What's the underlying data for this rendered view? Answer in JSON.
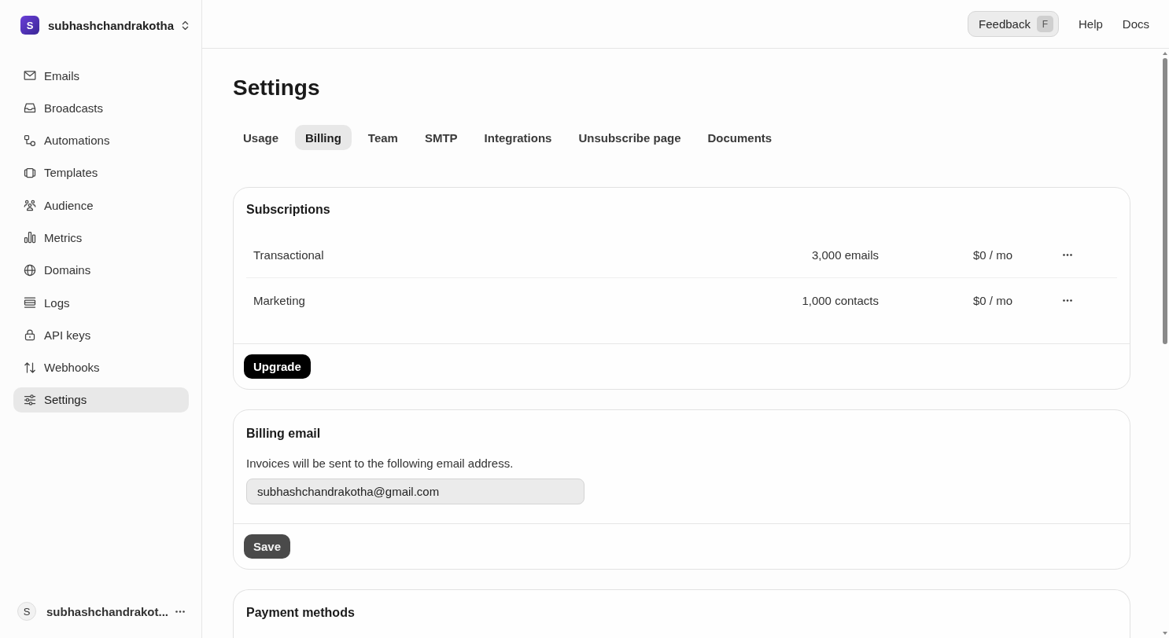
{
  "workspace": {
    "initial": "S",
    "name": "subhashchandrakotha"
  },
  "sidebar": {
    "items": [
      {
        "label": "Emails",
        "selected": false
      },
      {
        "label": "Broadcasts",
        "selected": false
      },
      {
        "label": "Automations",
        "selected": false
      },
      {
        "label": "Templates",
        "selected": false
      },
      {
        "label": "Audience",
        "selected": false
      },
      {
        "label": "Metrics",
        "selected": false
      },
      {
        "label": "Domains",
        "selected": false
      },
      {
        "label": "Logs",
        "selected": false
      },
      {
        "label": "API keys",
        "selected": false
      },
      {
        "label": "Webhooks",
        "selected": false
      },
      {
        "label": "Settings",
        "selected": true
      }
    ]
  },
  "user": {
    "initial": "S",
    "name": "subhashchandrakot..."
  },
  "topbar": {
    "feedback": {
      "label": "Feedback",
      "shortcut": "F"
    },
    "links": [
      "Help",
      "Docs"
    ]
  },
  "page": {
    "title": "Settings"
  },
  "tabs": [
    {
      "label": "Usage",
      "selected": false
    },
    {
      "label": "Billing",
      "selected": true
    },
    {
      "label": "Team",
      "selected": false
    },
    {
      "label": "SMTP",
      "selected": false
    },
    {
      "label": "Integrations",
      "selected": false
    },
    {
      "label": "Unsubscribe page",
      "selected": false
    },
    {
      "label": "Documents",
      "selected": false
    }
  ],
  "subscriptions": {
    "title": "Subscriptions",
    "rows": [
      {
        "name": "Transactional",
        "quota": "3,000 emails",
        "price": "$0 / mo"
      },
      {
        "name": "Marketing",
        "quota": "1,000 contacts",
        "price": "$0 / mo"
      }
    ],
    "action": {
      "label": "Upgrade",
      "disabled": false
    }
  },
  "billing_email": {
    "title": "Billing email",
    "description": "Invoices will be sent to the following email address.",
    "value": "subhashchandrakotha@gmail.com",
    "action": {
      "label": "Save",
      "disabled": true
    }
  },
  "payment_methods": {
    "title": "Payment methods"
  }
}
